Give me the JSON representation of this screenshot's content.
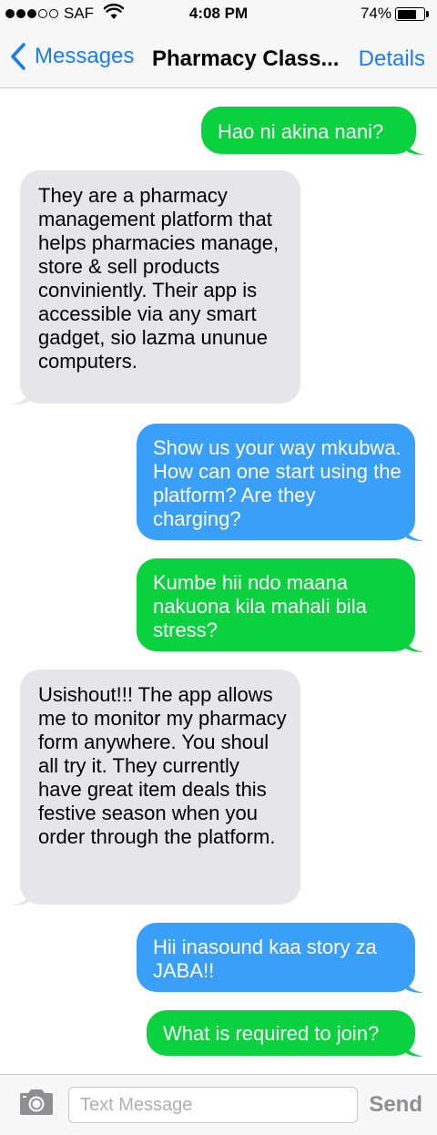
{
  "status_bar": {
    "carrier": "SAF",
    "time": "4:08 PM",
    "battery_percent": "74%",
    "battery_level": 0.74,
    "signal_bars": 3,
    "signal_total": 5
  },
  "nav": {
    "back_label": "Messages",
    "title": "Pharmacy Class...",
    "details_label": "Details"
  },
  "colors": {
    "green_bubble": "#0ad23e",
    "blue_bubble": "#3a9ff9",
    "incoming_bubble": "#e5e5ea",
    "link_blue": "#1a7cf5"
  },
  "messages": [
    {
      "direction": "outgoing",
      "color": "green",
      "text": "Hao ni akina nani?"
    },
    {
      "direction": "incoming",
      "color": "gray",
      "text": "They are a pharmacy management platform that helps pharmacies manage, store & sell products conviniently. Their app is accessible via any smart gadget, sio lazma ununue computers."
    },
    {
      "direction": "outgoing",
      "color": "blue",
      "text": "Show us your way mkubwa. How can one start using the platform? Are they charging?"
    },
    {
      "direction": "outgoing",
      "color": "green",
      "text": "Kumbe hii ndo maana nakuona kila mahali bila stress?"
    },
    {
      "direction": "incoming",
      "color": "gray",
      "text": "Usishout!!! The app allows me to monitor my pharmacy form anywhere. You shoul all try it. They currently have great item deals this festive season when you order through the platform."
    },
    {
      "direction": "outgoing",
      "color": "blue",
      "text": "Hii inasound kaa story za JABA!!"
    },
    {
      "direction": "outgoing",
      "color": "green",
      "text": "What is required to join?"
    }
  ],
  "input": {
    "placeholder": "Text Message",
    "value": "",
    "send_label": "Send"
  },
  "icons": {
    "back": "chevron-left-icon",
    "camera": "camera-icon",
    "wifi": "wifi-icon",
    "battery": "battery-icon"
  }
}
